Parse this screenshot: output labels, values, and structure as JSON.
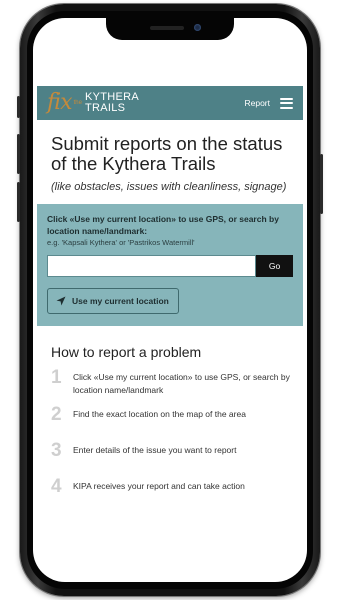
{
  "header": {
    "logo_fix": "fix",
    "logo_the": "the",
    "logo_line1": "KYTHERA",
    "logo_line2": "TRAILS",
    "report_label": "Report",
    "menu_icon": "hamburger-menu-icon"
  },
  "main": {
    "title": "Submit reports on the status of the Kythera Trails",
    "subtitle": "(like obstacles, issues with cleanliness, signage)"
  },
  "search": {
    "instruction": "Click «Use my current location» to use GPS, or search by location name/landmark:",
    "example": "e.g. 'Kapsali Kythera' or 'Pastrikos Watermill'",
    "input_value": "",
    "placeholder": "",
    "go_label": "Go",
    "locate_label": "Use my current location",
    "locate_icon": "location-arrow-icon"
  },
  "howto": {
    "title": "How to report a problem",
    "steps": [
      {
        "num": "1",
        "text": "Click «Use my current location» to use GPS, or search by location name/landmark"
      },
      {
        "num": "2",
        "text": "Find the exact location on the map of the area"
      },
      {
        "num": "3",
        "text": "Enter details of the issue you want to report"
      },
      {
        "num": "4",
        "text": "KIPA receives your report and can take action"
      }
    ]
  },
  "colors": {
    "header_bg": "#4e8187",
    "panel_bg": "#86b5ba",
    "logo_accent": "#c48a3c",
    "go_bg": "#111111"
  }
}
